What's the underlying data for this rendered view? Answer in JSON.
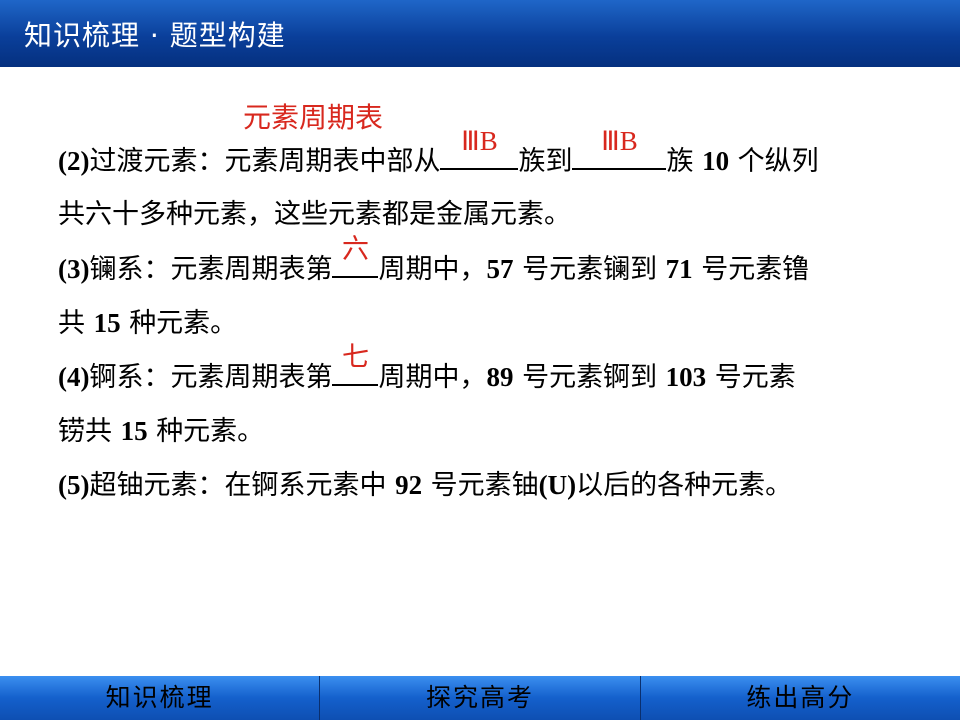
{
  "header": {
    "title": "知识梳理 · 题型构建"
  },
  "heading": "元素周期表",
  "p2": {
    "num": "(2)",
    "t1": "过渡元素：元素周期表中部从",
    "a1": "ⅢB",
    "t2": "族到",
    "a2": "ⅢB",
    "t3": "族",
    "n1": "10",
    "t4": "个纵列",
    "line2": "共六十多种元素，这些元素都是金属元素。"
  },
  "p3": {
    "num": "(3)",
    "t1": "镧系：元素周期表第",
    "a1": "六",
    "t2": "周期中，",
    "n1": "57",
    "t3": "号元素镧到",
    "n2": "71",
    "t4": "号元素镥",
    "t5": "共",
    "n3": "15",
    "t6": "种元素。"
  },
  "p4": {
    "num": "(4)",
    "t1": "锕系：元素周期表第",
    "a1": "七",
    "t2": "周期中，",
    "n1": "89",
    "t3": "号元素锕到",
    "n2": "103",
    "t4": "号元素",
    "t5": "铹共",
    "n3": "15",
    "t6": "种元素。"
  },
  "p5": {
    "num": "(5)",
    "t1": "超铀元素：在锕系元素中",
    "n1": "92",
    "t2": "号元素铀",
    "n2": "(U)",
    "t3": "以后的各种元素。"
  },
  "nav": {
    "item1": "知识梳理",
    "item2": "探究高考",
    "item3": "练出高分"
  }
}
